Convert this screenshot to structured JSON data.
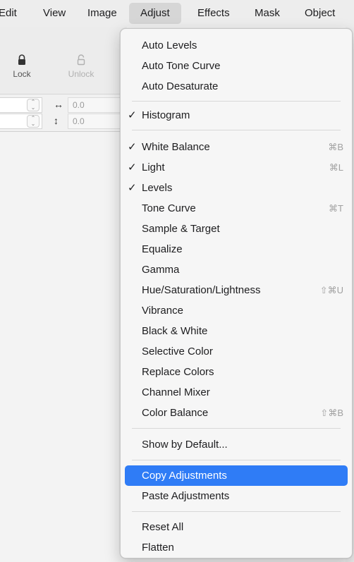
{
  "menubar": {
    "items": [
      "Edit",
      "View",
      "Image",
      "Adjust",
      "Effects",
      "Mask",
      "Object"
    ],
    "active": "Adjust"
  },
  "toolbar": {
    "lock_label": "Lock",
    "unlock_label": "Unlock"
  },
  "fields": {
    "width_value": "0.0",
    "height_value": "0.0"
  },
  "menu": {
    "items": [
      {
        "label": "Auto Levels",
        "checked": false,
        "shortcut": ""
      },
      {
        "label": "Auto Tone Curve",
        "checked": false,
        "shortcut": ""
      },
      {
        "label": "Auto Desaturate",
        "checked": false,
        "shortcut": ""
      },
      {
        "label": "Histogram",
        "checked": true,
        "shortcut": ""
      },
      {
        "label": "White Balance",
        "checked": true,
        "shortcut": "⌘B"
      },
      {
        "label": "Light",
        "checked": true,
        "shortcut": "⌘L"
      },
      {
        "label": "Levels",
        "checked": true,
        "shortcut": ""
      },
      {
        "label": "Tone Curve",
        "checked": false,
        "shortcut": "⌘T"
      },
      {
        "label": "Sample & Target",
        "checked": false,
        "shortcut": ""
      },
      {
        "label": "Equalize",
        "checked": false,
        "shortcut": ""
      },
      {
        "label": "Gamma",
        "checked": false,
        "shortcut": ""
      },
      {
        "label": "Hue/Saturation/Lightness",
        "checked": false,
        "shortcut": "⇧⌘U"
      },
      {
        "label": "Vibrance",
        "checked": false,
        "shortcut": ""
      },
      {
        "label": "Black & White",
        "checked": false,
        "shortcut": ""
      },
      {
        "label": "Selective Color",
        "checked": false,
        "shortcut": ""
      },
      {
        "label": "Replace Colors",
        "checked": false,
        "shortcut": ""
      },
      {
        "label": "Channel Mixer",
        "checked": false,
        "shortcut": ""
      },
      {
        "label": "Color Balance",
        "checked": false,
        "shortcut": "⇧⌘B"
      },
      {
        "label": "Show by Default...",
        "checked": false,
        "shortcut": ""
      },
      {
        "label": "Copy Adjustments",
        "checked": false,
        "shortcut": "",
        "highlighted": true
      },
      {
        "label": "Paste Adjustments",
        "checked": false,
        "shortcut": ""
      },
      {
        "label": "Reset All",
        "checked": false,
        "shortcut": ""
      },
      {
        "label": "Flatten",
        "checked": false,
        "shortcut": ""
      }
    ],
    "check_glyph": "✓",
    "highlight_color": "#2f7cf6"
  }
}
